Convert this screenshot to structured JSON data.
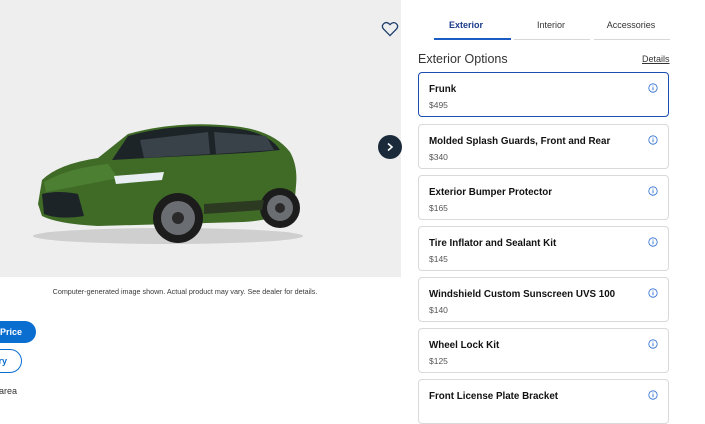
{
  "image": {
    "disclaimer": "Computer-generated image shown. Actual product may vary. See dealer for details.",
    "favorite_icon": "heart-outline-icon",
    "next_icon": "chevron-right-icon",
    "car_color": "#3f6b27"
  },
  "actions": {
    "price_button": "t Price",
    "inventory_button": "ry",
    "area_text": "area"
  },
  "tabs": [
    {
      "label": "Exterior",
      "active": true
    },
    {
      "label": "Interior",
      "active": false
    },
    {
      "label": "Accessories",
      "active": false
    }
  ],
  "options": {
    "title": "Exterior Options",
    "details_link": "Details",
    "items": [
      {
        "name": "Frunk",
        "price": "$495",
        "selected": true
      },
      {
        "name": "Molded Splash Guards, Front and Rear",
        "price": "$340",
        "selected": false
      },
      {
        "name": "Exterior Bumper Protector",
        "price": "$165",
        "selected": false
      },
      {
        "name": "Tire Inflator and Sealant Kit",
        "price": "$145",
        "selected": false
      },
      {
        "name": "Windshield Custom Sunscreen UVS 100",
        "price": "$140",
        "selected": false
      },
      {
        "name": "Wheel Lock Kit",
        "price": "$125",
        "selected": false
      },
      {
        "name": "Front License Plate Bracket",
        "price": "",
        "selected": false
      }
    ]
  },
  "colors": {
    "accent_blue": "#0a6ed1",
    "selected_border": "#1a4fb0",
    "dark_button": "#1b2a3a"
  }
}
